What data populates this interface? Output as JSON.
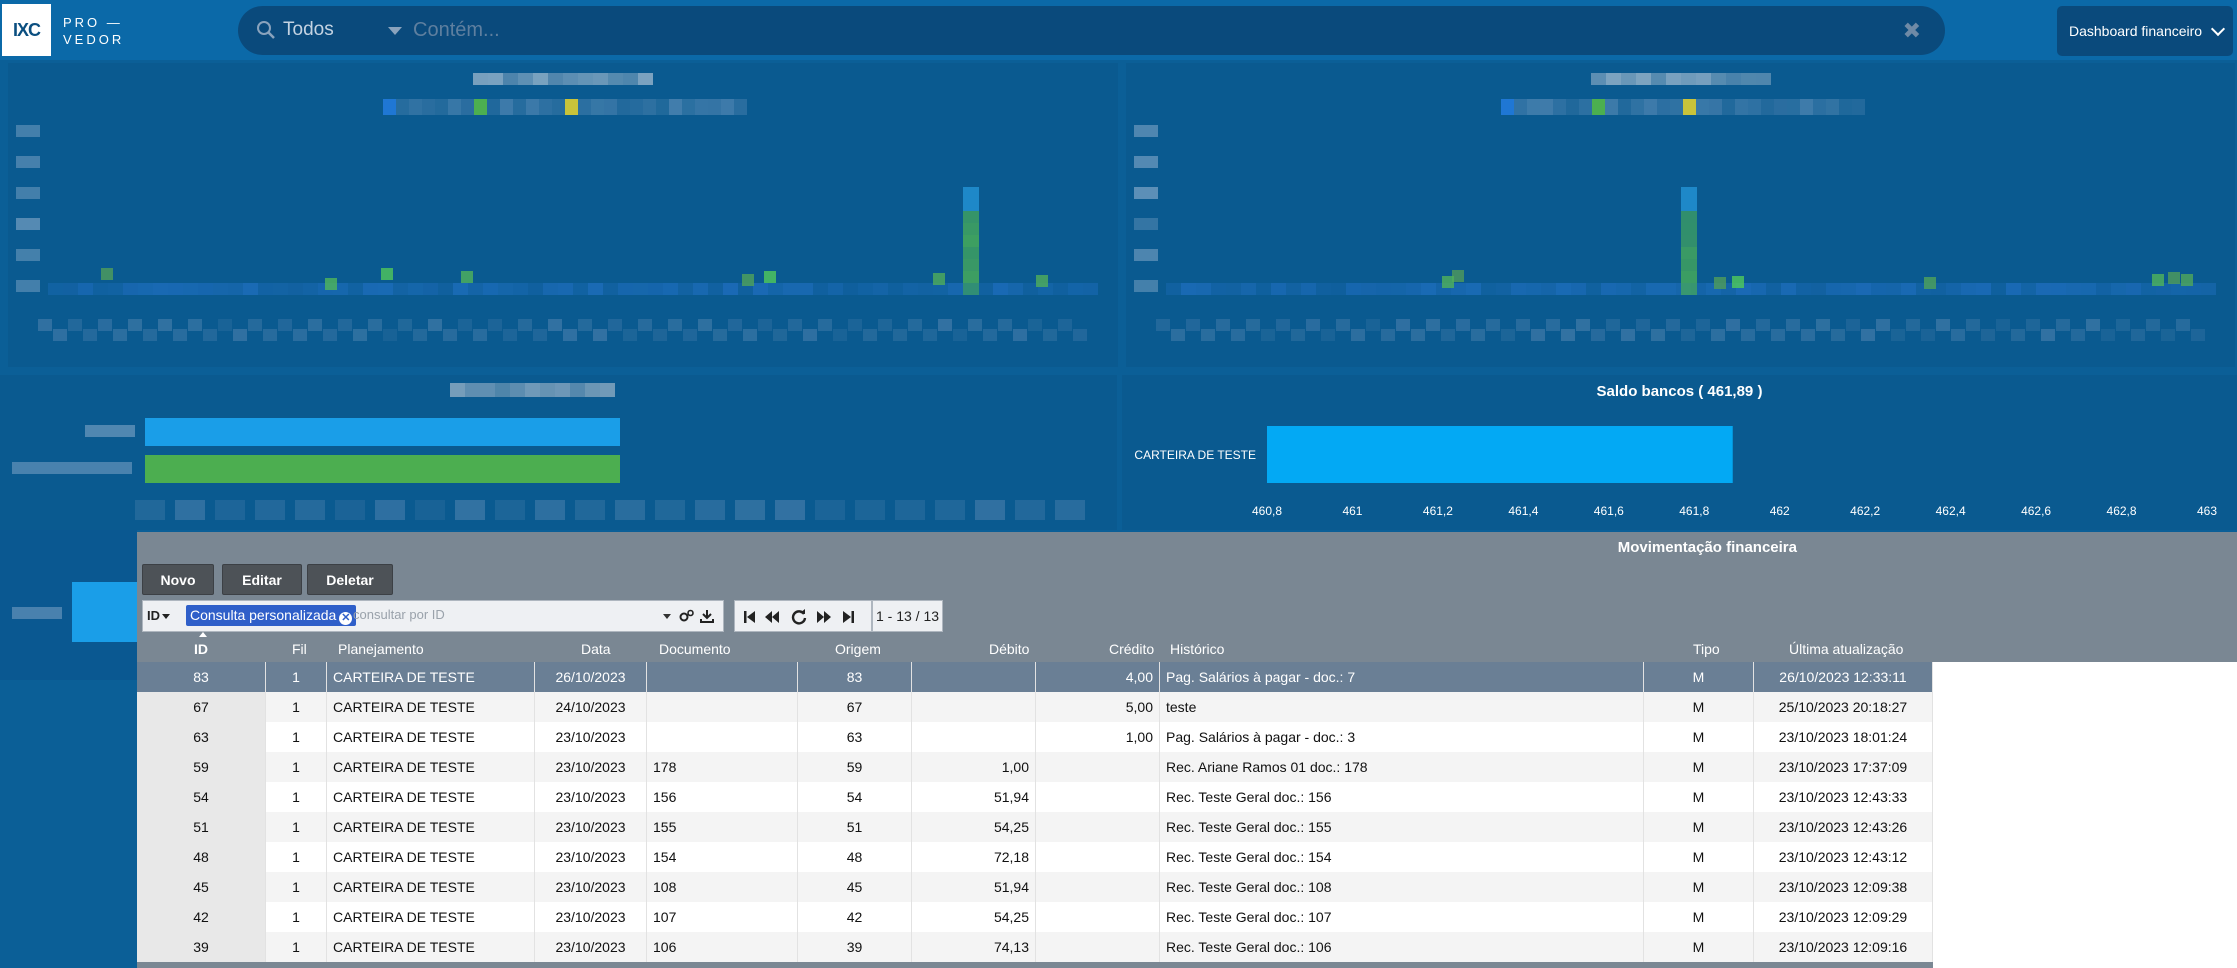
{
  "header": {
    "logo_text": "IXC",
    "brand_line1": "PRO —",
    "brand_line2": "VEDOR",
    "search_scope": "Todos",
    "search_placeholder": "Contém...",
    "dashboard_select": "Dashboard financeiro"
  },
  "chart_data": {
    "type": "bar",
    "title": "Saldo bancos ( 461,89 )",
    "orientation": "horizontal",
    "categories": [
      "CARTEIRA DE TESTE"
    ],
    "values": [
      461.89
    ],
    "xlim": [
      460.8,
      463
    ],
    "x_ticks": [
      "460,8",
      "461",
      "461,2",
      "461,4",
      "461,6",
      "461,8",
      "462",
      "462,2",
      "462,4",
      "462,6",
      "462,8",
      "463"
    ],
    "bar_color": "#03a9f4",
    "grid": false
  },
  "dialog": {
    "title": "Movimentação financeira",
    "buttons": {
      "new": "Novo",
      "edit": "Editar",
      "delete": "Deletar"
    },
    "filter": {
      "field": "ID",
      "chip": "Consulta personalizada",
      "placeholder": "consultar por ID"
    },
    "pager_count": "1 - 13 / 13",
    "columns": [
      "ID",
      "Fil",
      "Planejamento",
      "Data",
      "Documento",
      "Origem",
      "Débito",
      "Crédito",
      "Histórico",
      "Tipo",
      "Última atualização"
    ],
    "rows": [
      {
        "id": "83",
        "fil": "1",
        "plan": "CARTEIRA DE TESTE",
        "data": "26/10/2023",
        "doc": "",
        "origem": "83",
        "debito": "",
        "credito": "4,00",
        "hist": "Pag. Salários à pagar - doc.: 7",
        "tipo": "M",
        "atual": "26/10/2023 12:33:11"
      },
      {
        "id": "67",
        "fil": "1",
        "plan": "CARTEIRA DE TESTE",
        "data": "24/10/2023",
        "doc": "",
        "origem": "67",
        "debito": "",
        "credito": "5,00",
        "hist": "teste",
        "tipo": "M",
        "atual": "25/10/2023 20:18:27"
      },
      {
        "id": "63",
        "fil": "1",
        "plan": "CARTEIRA DE TESTE",
        "data": "23/10/2023",
        "doc": "",
        "origem": "63",
        "debito": "",
        "credito": "1,00",
        "hist": "Pag. Salários à pagar - doc.: 3",
        "tipo": "M",
        "atual": "23/10/2023 18:01:24"
      },
      {
        "id": "59",
        "fil": "1",
        "plan": "CARTEIRA DE TESTE",
        "data": "23/10/2023",
        "doc": "178",
        "origem": "59",
        "debito": "1,00",
        "credito": "",
        "hist": "Rec. Ariane Ramos 01 doc.: 178",
        "tipo": "M",
        "atual": "23/10/2023 17:37:09"
      },
      {
        "id": "54",
        "fil": "1",
        "plan": "CARTEIRA DE TESTE",
        "data": "23/10/2023",
        "doc": "156",
        "origem": "54",
        "debito": "51,94",
        "credito": "",
        "hist": "Rec. Teste Geral doc.: 156",
        "tipo": "M",
        "atual": "23/10/2023 12:43:33"
      },
      {
        "id": "51",
        "fil": "1",
        "plan": "CARTEIRA DE TESTE",
        "data": "23/10/2023",
        "doc": "155",
        "origem": "51",
        "debito": "54,25",
        "credito": "",
        "hist": "Rec. Teste Geral doc.: 155",
        "tipo": "M",
        "atual": "23/10/2023 12:43:26"
      },
      {
        "id": "48",
        "fil": "1",
        "plan": "CARTEIRA DE TESTE",
        "data": "23/10/2023",
        "doc": "154",
        "origem": "48",
        "debito": "72,18",
        "credito": "",
        "hist": "Rec. Teste Geral doc.: 154",
        "tipo": "M",
        "atual": "23/10/2023 12:43:12"
      },
      {
        "id": "45",
        "fil": "1",
        "plan": "CARTEIRA DE TESTE",
        "data": "23/10/2023",
        "doc": "108",
        "origem": "45",
        "debito": "51,94",
        "credito": "",
        "hist": "Rec. Teste Geral doc.: 108",
        "tipo": "M",
        "atual": "23/10/2023 12:09:38"
      },
      {
        "id": "42",
        "fil": "1",
        "plan": "CARTEIRA DE TESTE",
        "data": "23/10/2023",
        "doc": "107",
        "origem": "42",
        "debito": "54,25",
        "credito": "",
        "hist": "Rec. Teste Geral doc.: 107",
        "tipo": "M",
        "atual": "23/10/2023 12:09:29"
      },
      {
        "id": "39",
        "fil": "1",
        "plan": "CARTEIRA DE TESTE",
        "data": "23/10/2023",
        "doc": "106",
        "origem": "39",
        "debito": "74,13",
        "credito": "",
        "hist": "Rec. Teste Geral doc.: 106",
        "tipo": "M",
        "atual": "23/10/2023 12:09:16"
      }
    ]
  }
}
